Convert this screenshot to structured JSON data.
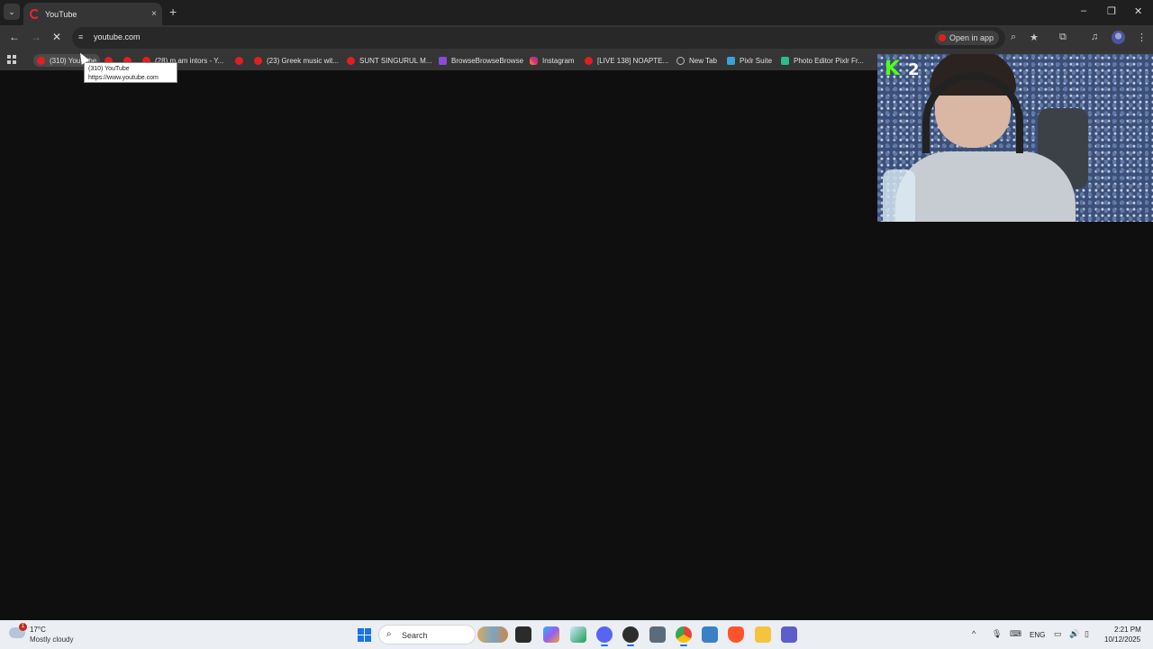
{
  "browser": {
    "tab": {
      "title": "YouTube",
      "close_glyph": "×"
    },
    "new_tab_glyph": "+",
    "tab_search_glyph": "⌄",
    "window_controls": {
      "minimize": "–",
      "restore": "❐",
      "close": "✕"
    },
    "nav": {
      "back": "←",
      "forward": "→",
      "stop": "✕"
    },
    "omnibox": {
      "url": "youtube.com",
      "site_info_glyph": "≡",
      "open_in_app": "Open in app",
      "zoom_glyph": "⌕",
      "bookmark_glyph": "★"
    },
    "toolbar_icons": {
      "extensions": "⧉",
      "media": "♫",
      "menu": "⋮"
    }
  },
  "bookmarks": [
    {
      "label": "(310) YouTube",
      "favicon": "youtube"
    },
    {
      "label": "",
      "favicon": "youtube"
    },
    {
      "label": "",
      "favicon": "youtube"
    },
    {
      "label": "(28) m am intors - Y...",
      "favicon": "youtube"
    },
    {
      "label": "",
      "favicon": "youtube"
    },
    {
      "label": "(23) Greek music wit...",
      "favicon": "youtube"
    },
    {
      "label": "SUNT SINGURUL M...",
      "favicon": "youtube"
    },
    {
      "label": "BrowseBrowseBrowse",
      "favicon": "twitch"
    },
    {
      "label": "Instagram",
      "favicon": "instagram"
    },
    {
      "label": "[LIVE 138] NOAPTE...",
      "favicon": "youtube"
    },
    {
      "label": "New Tab",
      "favicon": "globe"
    },
    {
      "label": "Pixlr Suite",
      "favicon": "pixlr"
    },
    {
      "label": "Photo Editor Pixlr Fr...",
      "favicon": "photo-editor"
    }
  ],
  "tooltip": {
    "title": "(310) YouTube",
    "url": "https://www.youtube.com"
  },
  "webcam_overlay": {
    "logo": "K",
    "count": "2"
  },
  "taskbar": {
    "weather": {
      "temp": "17°C",
      "condition": "Mostly cloudy",
      "badge": "1"
    },
    "search_placeholder": "Search",
    "tray": {
      "language": "ENG",
      "time": "2:21 PM",
      "date": "10/12/2025",
      "chevron": "^"
    }
  }
}
